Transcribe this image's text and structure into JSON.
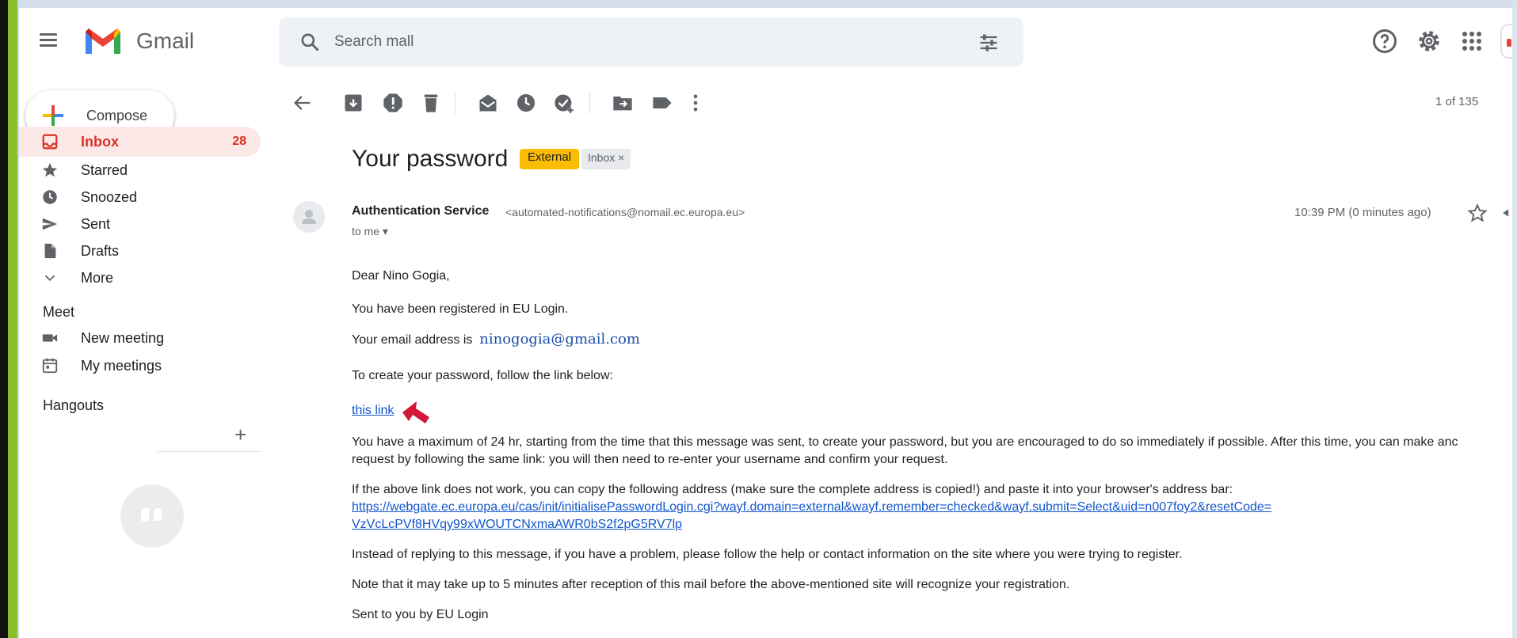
{
  "app": {
    "name": "Gmail"
  },
  "search": {
    "placeholder": "Search mall"
  },
  "compose": {
    "label": "Compose"
  },
  "sidebar": {
    "items": [
      {
        "label": "Inbox",
        "count": "28",
        "icon": "inbox-icon",
        "active": true
      },
      {
        "label": "Starred",
        "icon": "star-icon"
      },
      {
        "label": "Snoozed",
        "icon": "clock-icon"
      },
      {
        "label": "Sent",
        "icon": "send-icon"
      },
      {
        "label": "Drafts",
        "icon": "draft-icon"
      },
      {
        "label": "More",
        "icon": "chevron-down-icon"
      }
    ],
    "meet_title": "Meet",
    "meet_items": [
      {
        "label": "New meeting",
        "icon": "video-icon"
      },
      {
        "label": "My meetings",
        "icon": "calendar-icon"
      }
    ],
    "hangouts_title": "Hangouts",
    "hangouts_add": "+"
  },
  "toolbar": {
    "page_count": "1 of 135"
  },
  "message": {
    "subject": "Your password",
    "badge_external": "External",
    "badge_inbox": "Inbox ×",
    "sender_name": "Authentication Service",
    "sender_email": "<automated-notifications@nomail.ec.europa.eu>",
    "to": "to me ▾",
    "time": "10:39 PM (0 minutes ago)",
    "greeting": "Dear Nino Gogia,",
    "registered": "You have been registered in EU Login.",
    "email_prefix": "Your email address is",
    "email_value": "ninogogia@gmail.com",
    "create_pw": "To create your password, follow the link below:",
    "link_text": "this link",
    "max_line1": "You have a maximum of 24 hr, starting from the time that this message was sent, to create your password, but you are encouraged to do so immediately if possible. After this time, you can make anc",
    "max_line2": "request by following the same link: you will then need to re-enter your username and confirm your request.",
    "copy_line": "If the above link does not work, you can copy the following address (make sure the complete address is copied!) and paste it into your browser's address bar:",
    "url_line1": "https://webgate.ec.europa.eu/cas/init/initialisePasswordLogin.cgi?wayf.domain=external&wayf.remember=checked&wayf.submit=Select&uid=n007foy2&resetCode=",
    "url_line2": "VzVcLcPVf8HVqy99xWOUTCNxmaAWR0bS2f2pG5RV7lp",
    "help_line": "Instead of replying to this message, if you have a problem, please follow the help or contact information on the site where you were trying to register.",
    "note_line": "Note that it may take up to 5 minutes after reception of this mail before the above-mentioned site will recognize your registration.",
    "sent_by": "Sent to you by EU Login"
  },
  "colors": {
    "accent_red": "#d93025",
    "external_badge": "#fbbc04",
    "link": "#1155cc",
    "annotation_arrow": "#d3173b",
    "frame_green": "#8bbf2a"
  }
}
